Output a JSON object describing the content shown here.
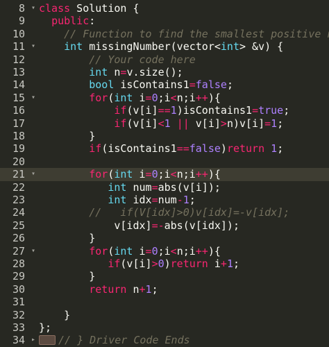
{
  "editor": {
    "active_line": 21,
    "lines": [
      {
        "num": "8",
        "fold": "▾",
        "indent": 0,
        "tokens": [
          {
            "c": "kw",
            "t": "class"
          },
          {
            "c": "plain",
            "t": " Solution {"
          }
        ]
      },
      {
        "num": "9",
        "fold": "",
        "indent": 0,
        "tokens": [
          {
            "c": "plain",
            "t": "  "
          },
          {
            "c": "kw",
            "t": "public"
          },
          {
            "c": "plain",
            "t": ":"
          }
        ]
      },
      {
        "num": "10",
        "fold": "",
        "indent": 0,
        "tokens": [
          {
            "c": "plain",
            "t": "    "
          },
          {
            "c": "cm",
            "t": "// Function to find the smallest positive n"
          }
        ]
      },
      {
        "num": "11",
        "fold": "▾",
        "indent": 0,
        "tokens": [
          {
            "c": "plain",
            "t": "    "
          },
          {
            "c": "ty",
            "t": "int"
          },
          {
            "c": "plain",
            "t": " missingNumber(vector<"
          },
          {
            "c": "ty",
            "t": "int"
          },
          {
            "c": "plain",
            "t": "> &v) {"
          }
        ]
      },
      {
        "num": "12",
        "fold": "",
        "indent": 0,
        "tokens": [
          {
            "c": "plain",
            "t": "        "
          },
          {
            "c": "cm",
            "t": "// Your code here"
          }
        ]
      },
      {
        "num": "13",
        "fold": "",
        "indent": 0,
        "tokens": [
          {
            "c": "plain",
            "t": "        "
          },
          {
            "c": "ty",
            "t": "int"
          },
          {
            "c": "plain",
            "t": " n"
          },
          {
            "c": "op",
            "t": "="
          },
          {
            "c": "plain",
            "t": "v.size();"
          }
        ]
      },
      {
        "num": "14",
        "fold": "",
        "indent": 0,
        "tokens": [
          {
            "c": "plain",
            "t": "        "
          },
          {
            "c": "ty",
            "t": "bool"
          },
          {
            "c": "plain",
            "t": " isContains1"
          },
          {
            "c": "op",
            "t": "="
          },
          {
            "c": "num",
            "t": "false"
          },
          {
            "c": "plain",
            "t": ";"
          }
        ]
      },
      {
        "num": "15",
        "fold": "▾",
        "indent": 0,
        "tokens": [
          {
            "c": "plain",
            "t": "        "
          },
          {
            "c": "kw",
            "t": "for"
          },
          {
            "c": "plain",
            "t": "("
          },
          {
            "c": "ty",
            "t": "int"
          },
          {
            "c": "plain",
            "t": " i"
          },
          {
            "c": "op",
            "t": "="
          },
          {
            "c": "num",
            "t": "0"
          },
          {
            "c": "plain",
            "t": ";i"
          },
          {
            "c": "op",
            "t": "<"
          },
          {
            "c": "plain",
            "t": "n;i"
          },
          {
            "c": "op",
            "t": "++"
          },
          {
            "c": "plain",
            "t": "){"
          }
        ]
      },
      {
        "num": "16",
        "fold": "",
        "indent": 0,
        "tokens": [
          {
            "c": "plain",
            "t": "            "
          },
          {
            "c": "kw",
            "t": "if"
          },
          {
            "c": "plain",
            "t": "(v[i]"
          },
          {
            "c": "op",
            "t": "=="
          },
          {
            "c": "num",
            "t": "1"
          },
          {
            "c": "plain",
            "t": ")isContains1"
          },
          {
            "c": "op",
            "t": "="
          },
          {
            "c": "num",
            "t": "true"
          },
          {
            "c": "plain",
            "t": ";"
          }
        ]
      },
      {
        "num": "17",
        "fold": "",
        "indent": 0,
        "tokens": [
          {
            "c": "plain",
            "t": "            "
          },
          {
            "c": "kw",
            "t": "if"
          },
          {
            "c": "plain",
            "t": "(v[i]"
          },
          {
            "c": "op",
            "t": "<"
          },
          {
            "c": "num",
            "t": "1"
          },
          {
            "c": "plain",
            "t": " "
          },
          {
            "c": "op",
            "t": "||"
          },
          {
            "c": "plain",
            "t": " v[i]"
          },
          {
            "c": "op",
            "t": ">"
          },
          {
            "c": "plain",
            "t": "n)v[i]"
          },
          {
            "c": "op",
            "t": "="
          },
          {
            "c": "num",
            "t": "1"
          },
          {
            "c": "plain",
            "t": ";"
          }
        ]
      },
      {
        "num": "18",
        "fold": "",
        "indent": 0,
        "tokens": [
          {
            "c": "plain",
            "t": "        }"
          }
        ]
      },
      {
        "num": "19",
        "fold": "",
        "indent": 0,
        "tokens": [
          {
            "c": "plain",
            "t": "        "
          },
          {
            "c": "kw",
            "t": "if"
          },
          {
            "c": "plain",
            "t": "(isContains1"
          },
          {
            "c": "op",
            "t": "=="
          },
          {
            "c": "num",
            "t": "false"
          },
          {
            "c": "plain",
            "t": ")"
          },
          {
            "c": "kw",
            "t": "return"
          },
          {
            "c": "plain",
            "t": " "
          },
          {
            "c": "num",
            "t": "1"
          },
          {
            "c": "plain",
            "t": ";"
          }
        ]
      },
      {
        "num": "20",
        "fold": "",
        "indent": 0,
        "tokens": [
          {
            "c": "plain",
            "t": ""
          }
        ]
      },
      {
        "num": "21",
        "fold": "▾",
        "indent": 0,
        "tokens": [
          {
            "c": "plain",
            "t": "        "
          },
          {
            "c": "kw",
            "t": "for"
          },
          {
            "c": "plain",
            "t": "("
          },
          {
            "c": "ty",
            "t": "int"
          },
          {
            "c": "plain",
            "t": " i"
          },
          {
            "c": "op",
            "t": "="
          },
          {
            "c": "num",
            "t": "0"
          },
          {
            "c": "plain",
            "t": ";i"
          },
          {
            "c": "op",
            "t": "<"
          },
          {
            "c": "plain",
            "t": "n;i"
          },
          {
            "c": "op",
            "t": "++"
          },
          {
            "c": "plain",
            "t": "){"
          }
        ]
      },
      {
        "num": "22",
        "fold": "",
        "indent": 0,
        "tokens": [
          {
            "c": "plain",
            "t": "           "
          },
          {
            "c": "ty",
            "t": "int"
          },
          {
            "c": "plain",
            "t": " num"
          },
          {
            "c": "op",
            "t": "="
          },
          {
            "c": "plain",
            "t": "abs(v[i]);"
          }
        ]
      },
      {
        "num": "23",
        "fold": "",
        "indent": 0,
        "tokens": [
          {
            "c": "plain",
            "t": "           "
          },
          {
            "c": "ty",
            "t": "int"
          },
          {
            "c": "plain",
            "t": " idx"
          },
          {
            "c": "op",
            "t": "="
          },
          {
            "c": "plain",
            "t": "num"
          },
          {
            "c": "op",
            "t": "-"
          },
          {
            "c": "num",
            "t": "1"
          },
          {
            "c": "plain",
            "t": ";"
          }
        ]
      },
      {
        "num": "24",
        "fold": "",
        "indent": 0,
        "tokens": [
          {
            "c": "plain",
            "t": "        "
          },
          {
            "c": "cm",
            "t": "//   if(V[idx]>0)v[idx]=-v[idx];"
          }
        ]
      },
      {
        "num": "25",
        "fold": "",
        "indent": 0,
        "tokens": [
          {
            "c": "plain",
            "t": "            v[idx]"
          },
          {
            "c": "op",
            "t": "=-"
          },
          {
            "c": "plain",
            "t": "abs(v[idx]);"
          }
        ]
      },
      {
        "num": "26",
        "fold": "",
        "indent": 0,
        "tokens": [
          {
            "c": "plain",
            "t": "        }"
          }
        ]
      },
      {
        "num": "27",
        "fold": "▾",
        "indent": 0,
        "tokens": [
          {
            "c": "plain",
            "t": "        "
          },
          {
            "c": "kw",
            "t": "for"
          },
          {
            "c": "plain",
            "t": "("
          },
          {
            "c": "ty",
            "t": "int"
          },
          {
            "c": "plain",
            "t": " i"
          },
          {
            "c": "op",
            "t": "="
          },
          {
            "c": "num",
            "t": "0"
          },
          {
            "c": "plain",
            "t": ";i"
          },
          {
            "c": "op",
            "t": "<"
          },
          {
            "c": "plain",
            "t": "n;i"
          },
          {
            "c": "op",
            "t": "++"
          },
          {
            "c": "plain",
            "t": "){"
          }
        ]
      },
      {
        "num": "28",
        "fold": "",
        "indent": 0,
        "tokens": [
          {
            "c": "plain",
            "t": "           "
          },
          {
            "c": "kw",
            "t": "if"
          },
          {
            "c": "plain",
            "t": "(v[i]"
          },
          {
            "c": "op",
            "t": ">"
          },
          {
            "c": "num",
            "t": "0"
          },
          {
            "c": "plain",
            "t": ")"
          },
          {
            "c": "kw",
            "t": "return"
          },
          {
            "c": "plain",
            "t": " i"
          },
          {
            "c": "op",
            "t": "+"
          },
          {
            "c": "num",
            "t": "1"
          },
          {
            "c": "plain",
            "t": ";"
          }
        ]
      },
      {
        "num": "29",
        "fold": "",
        "indent": 0,
        "tokens": [
          {
            "c": "plain",
            "t": "        }"
          }
        ]
      },
      {
        "num": "30",
        "fold": "",
        "indent": 0,
        "tokens": [
          {
            "c": "plain",
            "t": "        "
          },
          {
            "c": "kw",
            "t": "return"
          },
          {
            "c": "plain",
            "t": " n"
          },
          {
            "c": "op",
            "t": "+"
          },
          {
            "c": "num",
            "t": "1"
          },
          {
            "c": "plain",
            "t": ";"
          }
        ]
      },
      {
        "num": "31",
        "fold": "",
        "indent": 0,
        "tokens": [
          {
            "c": "plain",
            "t": ""
          }
        ]
      },
      {
        "num": "32",
        "fold": "",
        "indent": 0,
        "tokens": [
          {
            "c": "plain",
            "t": "    }"
          }
        ]
      },
      {
        "num": "33",
        "fold": "",
        "indent": 0,
        "tokens": [
          {
            "c": "plain",
            "t": "};"
          }
        ]
      },
      {
        "num": "34",
        "fold": "▸",
        "indent": 0,
        "fold_marker": true,
        "tokens": [
          {
            "c": "cm",
            "t": "// } Driver Code Ends"
          }
        ]
      }
    ]
  }
}
